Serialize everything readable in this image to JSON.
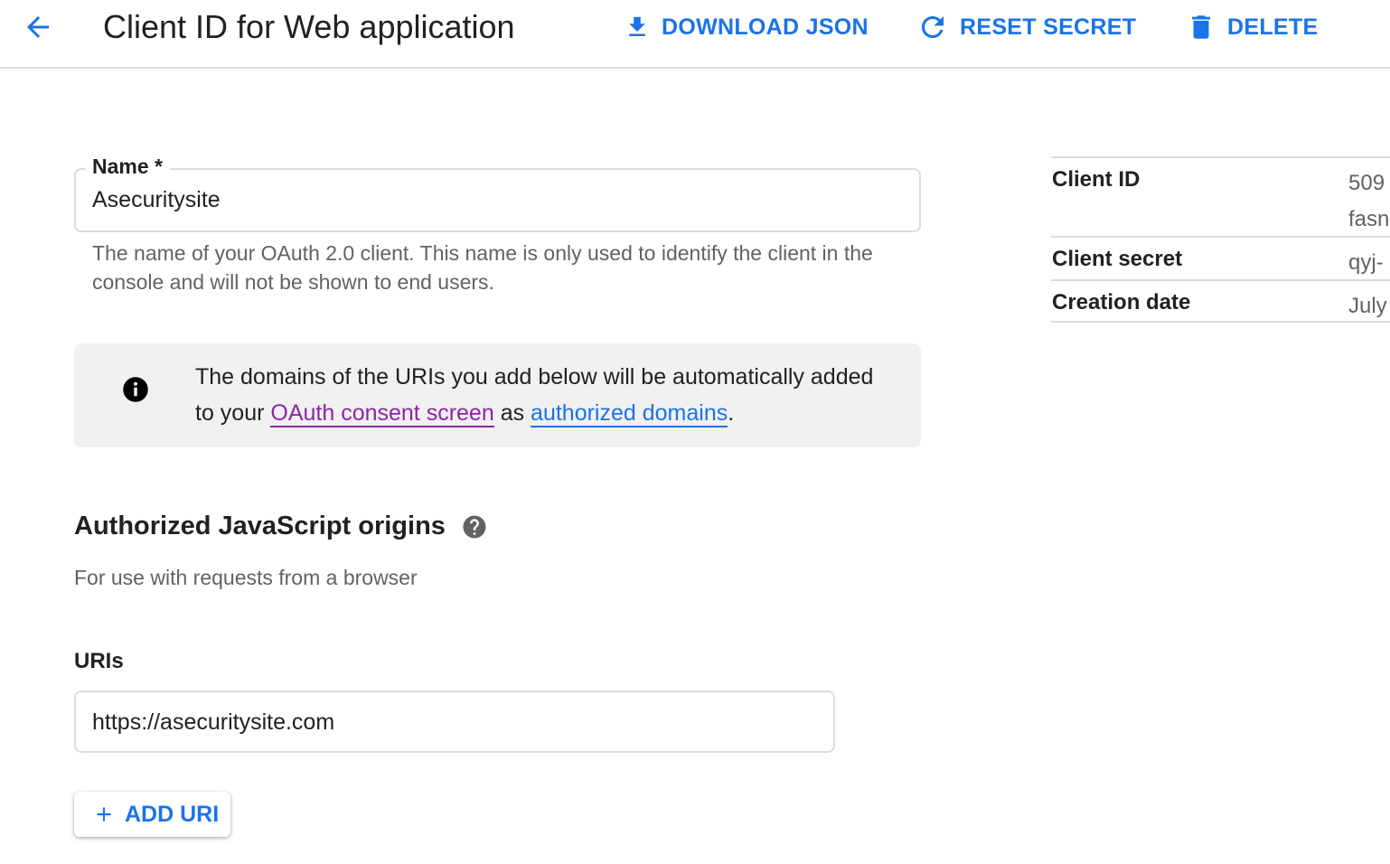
{
  "header": {
    "title": "Client ID for Web application",
    "actions": {
      "download_label": "DOWNLOAD JSON",
      "reset_label": "RESET SECRET",
      "delete_label": "DELETE"
    }
  },
  "name_field": {
    "label": "Name *",
    "value": "Asecuritysite",
    "help": "The name of your OAuth 2.0 client. This name is only used to identify the client in the console and will not be shown to end users."
  },
  "info_banner": {
    "text_before": "The domains of the URIs you add below will be automatically added to your ",
    "link1": "OAuth consent screen",
    "text_between": " as ",
    "link2": "authorized domains",
    "text_after": "."
  },
  "js_origins": {
    "title": "Authorized JavaScript origins",
    "subtitle": "For use with requests from a browser",
    "uris_label": "URIs",
    "uri_value": "https://asecuritysite.com",
    "add_button_label": "ADD URI"
  },
  "details": {
    "client_id_key": "Client ID",
    "client_id_val_1": "509",
    "client_id_val_2": "fasn",
    "client_secret_key": "Client secret",
    "client_secret_val": "qyj-",
    "creation_date_key": "Creation date",
    "creation_date_val": "July"
  },
  "colors": {
    "accent": "#1a73e8",
    "visited_link": "#8e24aa",
    "banner_bg": "#f1f1f1",
    "border": "#dadce0"
  },
  "icons": [
    "arrow-back-icon",
    "download-icon",
    "refresh-icon",
    "trash-icon",
    "info-icon",
    "help-icon",
    "plus-icon"
  ]
}
